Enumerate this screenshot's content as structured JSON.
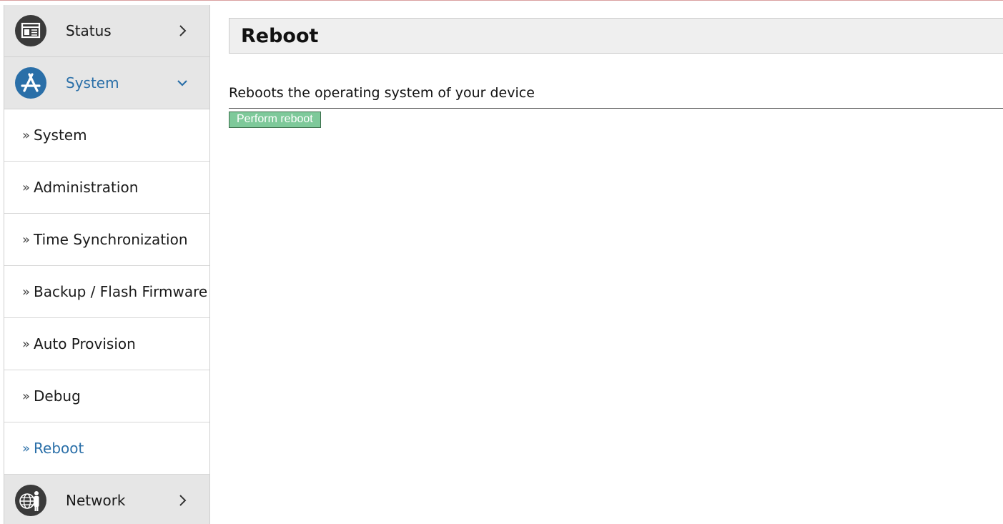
{
  "sidebar": {
    "sections": [
      {
        "label": "Status",
        "icon": "status-icon",
        "state": "collapsed"
      },
      {
        "label": "System",
        "icon": "system-app-icon",
        "state": "expanded"
      },
      {
        "label": "Network",
        "icon": "network-icon",
        "state": "collapsed"
      }
    ],
    "system_items": [
      {
        "label": "System"
      },
      {
        "label": "Administration"
      },
      {
        "label": "Time Synchronization"
      },
      {
        "label": "Backup / Flash Firmware"
      },
      {
        "label": "Auto Provision"
      },
      {
        "label": "Debug"
      },
      {
        "label": "Reboot",
        "active": true
      }
    ],
    "raquo": "»"
  },
  "main": {
    "title": "Reboot",
    "description": "Reboots the operating system of your device",
    "button_label": "Perform reboot"
  },
  "colors": {
    "accent": "#2a6fa8",
    "button_bg": "#7ec99a",
    "section_bg": "#e6e6e6",
    "header_bg": "#efefef"
  }
}
